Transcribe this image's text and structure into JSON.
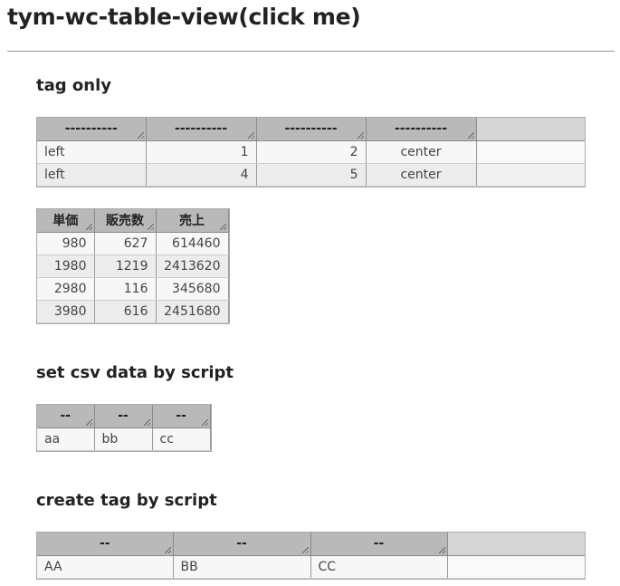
{
  "page": {
    "title": "tym-wc-table-view(click me)"
  },
  "section1": {
    "heading": "tag only",
    "headers": [
      "----------",
      "----------",
      "----------",
      "----------"
    ],
    "rows": [
      [
        "left",
        "1",
        "2",
        "center"
      ],
      [
        "left",
        "4",
        "5",
        "center"
      ]
    ]
  },
  "section1b": {
    "headers": [
      "単価",
      "販売数",
      "売上"
    ],
    "rows": [
      [
        "980",
        "627",
        "614460"
      ],
      [
        "1980",
        "1219",
        "2413620"
      ],
      [
        "2980",
        "116",
        "345680"
      ],
      [
        "3980",
        "616",
        "2451680"
      ]
    ]
  },
  "section2": {
    "heading": "set csv data by script",
    "headers": [
      "--",
      "--",
      "--"
    ],
    "rows": [
      [
        "aa",
        "bb",
        "cc"
      ]
    ]
  },
  "section3": {
    "heading": "create tag by script",
    "headers": [
      "--",
      "--",
      "--"
    ],
    "rows": [
      [
        "AA",
        "BB",
        "CC"
      ]
    ]
  }
}
